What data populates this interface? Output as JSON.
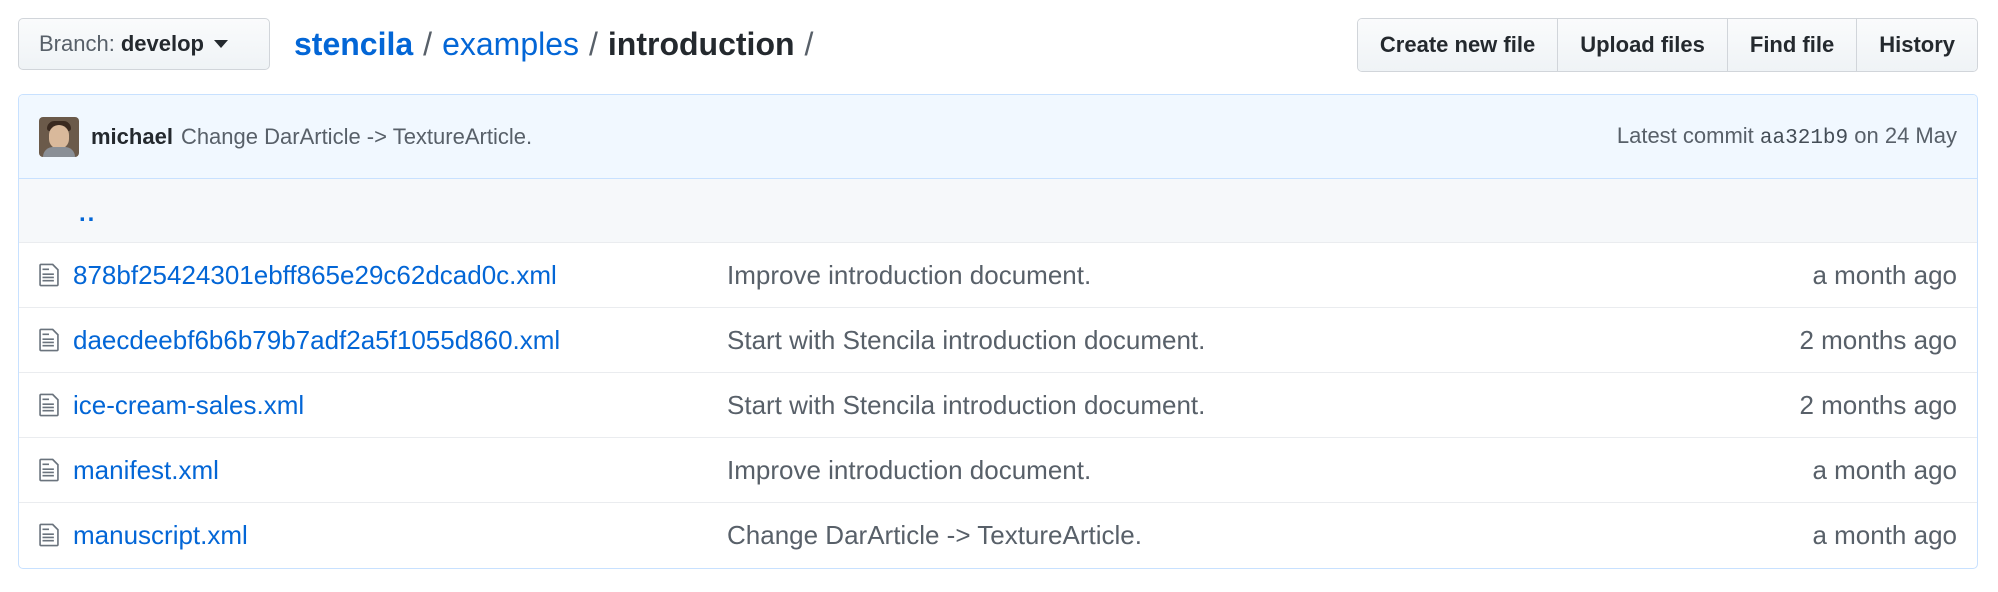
{
  "branch": {
    "label": "Branch:",
    "value": "develop"
  },
  "breadcrumb": {
    "repo": "stencila",
    "path": [
      "examples"
    ],
    "current": "introduction",
    "separator": "/"
  },
  "actions": {
    "create_new_file": "Create new file",
    "upload_files": "Upload files",
    "find_file": "Find file",
    "history": "History"
  },
  "commit": {
    "author": "michael",
    "message": "Change DarArticle -> TextureArticle.",
    "prefix": "Latest commit",
    "sha": "aa321b9",
    "date_text": "on 24 May"
  },
  "parent_dir": "..",
  "files": [
    {
      "name": "878bf25424301ebff865e29c62dcad0c.xml",
      "message": "Improve introduction document.",
      "age": "a month ago"
    },
    {
      "name": "daecdeebf6b6b79b7adf2a5f1055d860.xml",
      "message": "Start with Stencila introduction document.",
      "age": "2 months ago"
    },
    {
      "name": "ice-cream-sales.xml",
      "message": "Start with Stencila introduction document.",
      "age": "2 months ago"
    },
    {
      "name": "manifest.xml",
      "message": "Improve introduction document.",
      "age": "a month ago"
    },
    {
      "name": "manuscript.xml",
      "message": "Change DarArticle -> TextureArticle.",
      "age": "a month ago"
    }
  ],
  "icons": {
    "file": "file-icon",
    "caret": "caret-down-icon"
  },
  "colors": {
    "link": "#0366d6",
    "muted": "#586069",
    "commit_bg": "#f1f8ff"
  }
}
